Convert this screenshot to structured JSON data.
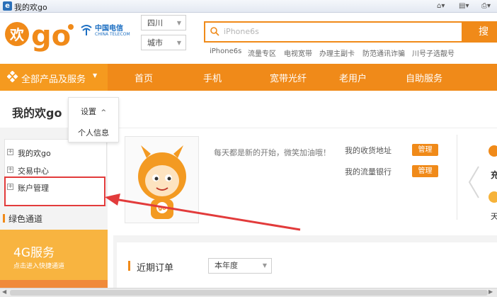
{
  "window": {
    "title": "我的欢go"
  },
  "brand": {
    "logo_text": "欢go",
    "telecom_cn": "中国电信",
    "telecom_en": "CHINA TELECOM"
  },
  "location": {
    "province": "四川",
    "city": "城市"
  },
  "search": {
    "placeholder": "iPhone6s",
    "button_label": "搜索"
  },
  "hot_links": [
    "iPhone6s",
    "流量专区",
    "电视宽带",
    "办理主副卡",
    "防范通讯诈骗",
    "川号子选靓号"
  ],
  "nav": {
    "all_products": "全部产品及服务",
    "items": [
      "首页",
      "手机",
      "宽带光纤",
      "老用户",
      "自助服务"
    ]
  },
  "page": {
    "title": "我的欢go"
  },
  "dropdown": {
    "header": "设置",
    "items": [
      "个人信息"
    ]
  },
  "sidebar": {
    "items": [
      "我的欢go",
      "交易中心",
      "账户管理"
    ],
    "green_channel": "绿色通道",
    "promo_title": "4G服务",
    "promo_subtitle": "点击进入快捷通道"
  },
  "profile": {
    "welcome": "每天都是新的开始，微笑加油哦！",
    "links": [
      {
        "label": "我的收货地址",
        "button": "管理"
      },
      {
        "label": "我的流量银行",
        "button": "管理"
      }
    ],
    "side_labels": [
      "充",
      "天"
    ]
  },
  "orders": {
    "title": "近期订单",
    "year_filter": "本年度"
  },
  "colors": {
    "accent": "#f08a19",
    "nav_dark": "#f59a1f",
    "promo": "#f8b440",
    "annotation_red": "#e23b3b"
  }
}
